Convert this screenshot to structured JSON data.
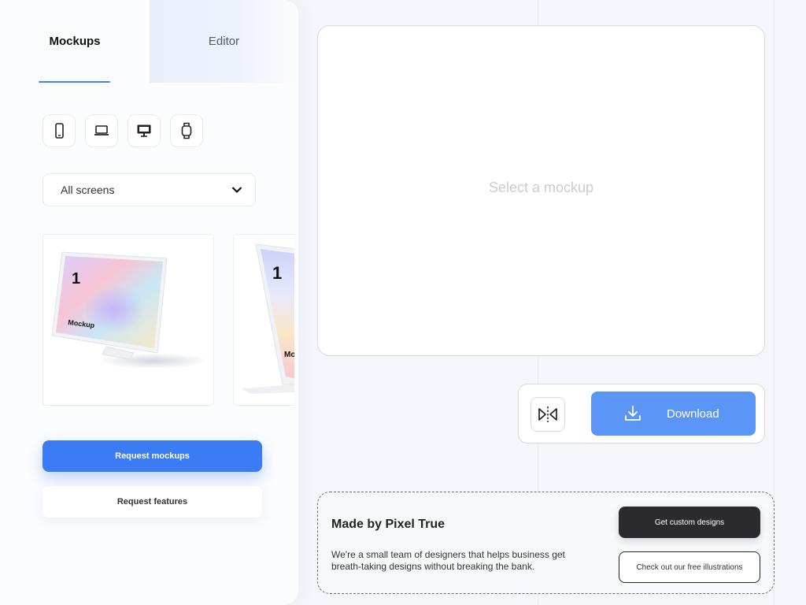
{
  "tabs": {
    "mockups": "Mockups",
    "editor": "Editor"
  },
  "devices": [
    "phone-icon",
    "laptop-icon",
    "desktop-icon",
    "watch-icon"
  ],
  "filter": {
    "selected": "All screens"
  },
  "mockup_cards": [
    {
      "number": "1",
      "label": "Mockup"
    },
    {
      "number": "1",
      "label": "Mo"
    }
  ],
  "sidebar_buttons": {
    "request_mockups": "Request mockups",
    "request_features": "Request features"
  },
  "preview": {
    "placeholder": "Select a mockup"
  },
  "actions": {
    "download": "Download"
  },
  "promo": {
    "title": "Made by Pixel True",
    "description": "We're a small team of designers that helps business get breath-taking designs without breaking the bank.",
    "custom_designs": "Get custom designs",
    "free_illustrations": "Check out our free illustrations"
  },
  "colors": {
    "accent": "#3b7cf5",
    "download": "#5b95f7",
    "dark_button": "#2b2b2e"
  }
}
